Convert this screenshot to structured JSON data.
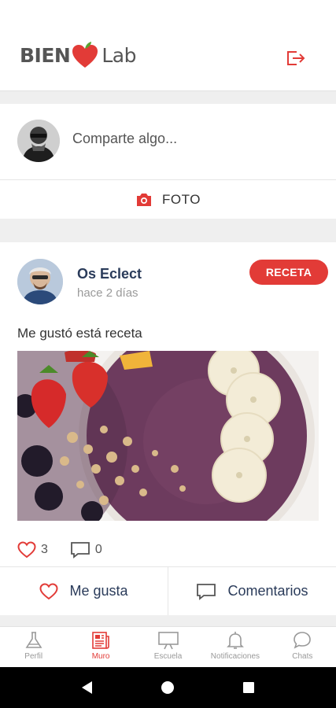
{
  "app": {
    "logo_left": "BIEN",
    "logo_right": "Lab"
  },
  "composer": {
    "placeholder": "Comparte algo...",
    "photo_label": "FOTO"
  },
  "post": {
    "author": "Os Eclect",
    "time": "hace 2 días",
    "badge": "RECETA",
    "text": "Me gustó está receta",
    "likes": "3",
    "comments": "0",
    "like_label": "Me gusta",
    "comment_label": "Comentarios"
  },
  "tabs": [
    {
      "label": "Perfil",
      "icon": "flask-icon",
      "active": false
    },
    {
      "label": "Muro",
      "icon": "newspaper-icon",
      "active": true
    },
    {
      "label": "Escuela",
      "icon": "presentation-board-icon",
      "active": false
    },
    {
      "label": "Notificaciones",
      "icon": "bell-icon",
      "active": false
    },
    {
      "label": "Chats",
      "icon": "chat-bubble-icon",
      "active": false
    }
  ],
  "colors": {
    "accent": "#e23b37",
    "navy": "#2a3b5a",
    "muted": "#9a9a9a",
    "background": "#efefef"
  }
}
